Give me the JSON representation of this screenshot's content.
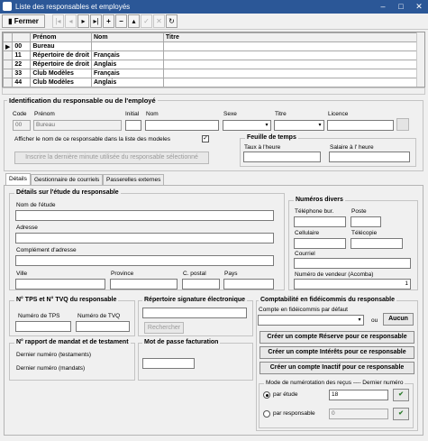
{
  "window": {
    "title": "Liste des responsables et employés"
  },
  "toolbar": {
    "close_label": "Fermer",
    "refresh_symbol": "↻"
  },
  "grid": {
    "columns": [
      "",
      "Prénom",
      "Nom",
      "Titre"
    ],
    "rows": [
      {
        "code": "00",
        "prenom": "Bureau",
        "nom": "",
        "titre": ""
      },
      {
        "code": "11",
        "prenom": "Répertoire de droit",
        "nom": "Français",
        "titre": ""
      },
      {
        "code": "22",
        "prenom": "Répertoire de droit",
        "nom": "Anglais",
        "titre": ""
      },
      {
        "code": "33",
        "prenom": "Club Modèles",
        "nom": "Français",
        "titre": ""
      },
      {
        "code": "44",
        "prenom": "Club Modèles",
        "nom": "Anglais",
        "titre": ""
      }
    ]
  },
  "ident": {
    "title": "Identification du responsable ou de l'employé",
    "code_label": "Code",
    "code_value": "00",
    "prenom_label": "Prénom",
    "prenom_value": "Bureau",
    "initial_label": "Initial",
    "nom_label": "Nom",
    "sexe_label": "Sexe",
    "titre_label": "Titre",
    "licence_label": "Licence",
    "show_name_label": "Afficher le nom de ce responsable dans la liste des modeles",
    "show_name_checked": "✓",
    "inscrire_label": "Inscrire la dernière minute utilisée du responsable sélectionné"
  },
  "timesheet": {
    "title": "Feuille de temps",
    "hourly_label": "Taux à l'heure",
    "salary_label": "Salaire à l' heure"
  },
  "tabs": [
    "Détails",
    "Gestionnaire de courriels",
    "Passerelles externes"
  ],
  "details": {
    "title": "Détails sur l'étude du responsable",
    "firm_name": "Nom de l'étude",
    "address": "Adresse",
    "address2": "Complément d'adresse",
    "city": "Ville",
    "province": "Province",
    "postal": "C. postal",
    "country": "Pays"
  },
  "numbers": {
    "title": "Numéros divers",
    "office_phone": "Téléphone bur.",
    "ext": "Poste",
    "cell": "Cellulaire",
    "fax": "Télécopie",
    "email": "Courriel",
    "vendor": "Numéro de vendeur (Acomba)",
    "vendor_value": "1"
  },
  "tax": {
    "title": "N° TPS et N° TVQ du responsable",
    "tps": "Numéro de TPS",
    "tvq": "Numéro de TVQ"
  },
  "signature": {
    "title": "Répertoire signature électronique",
    "search": "Rechercher"
  },
  "trust": {
    "title": "Comptabilité en fidéicommis du responsable",
    "default_label": "Compte en fidéicommis par défaut",
    "or": "ou",
    "none": "Aucun",
    "create_reserve": "Créer un compte Réserve pour ce responsable",
    "create_interest": "Créer un compte Intérêts pour ce responsable",
    "create_inactive": "Créer un compte Inactif pour ce responsable",
    "numbering_title": "Mode de numérotation des reçus ---- Dernier numéro",
    "by_firm": "par étude",
    "by_firm_value": "18",
    "by_resp": "par responsable",
    "by_resp_value": "0"
  },
  "mandate": {
    "title": "N° rapport de mandat et de testament",
    "last_testaments": "Dernier numéro (testaments)",
    "last_mandats": "Dernier numéro (mandats)"
  },
  "password": {
    "title": "Mot de passe facturation"
  }
}
